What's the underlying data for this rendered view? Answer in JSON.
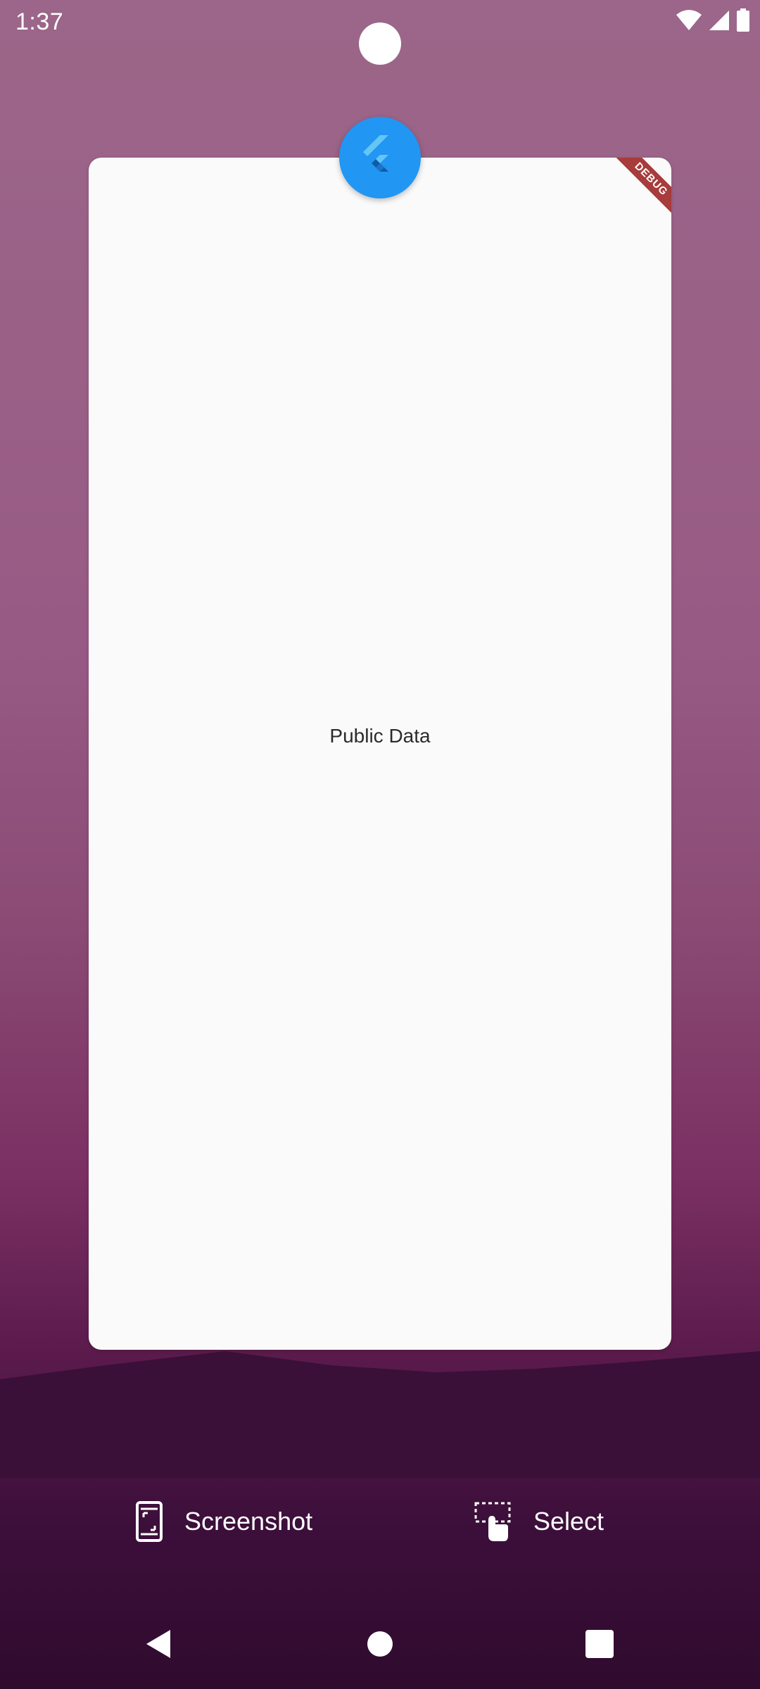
{
  "status_bar": {
    "time": "1:37",
    "icons": [
      "wifi-icon",
      "cellular-signal-icon",
      "battery-icon"
    ]
  },
  "recents_card": {
    "app_icon": "flutter-logo-icon",
    "debug_banner": "DEBUG",
    "content_text": "Public Data"
  },
  "actions": {
    "screenshot_label": "Screenshot",
    "select_label": "Select"
  },
  "navigation": {
    "buttons": [
      "back",
      "home",
      "recents"
    ]
  },
  "colors": {
    "app_icon_bg": "#2196f3",
    "card_bg": "#fafafa",
    "debug_ribbon": "#a83b3b"
  }
}
